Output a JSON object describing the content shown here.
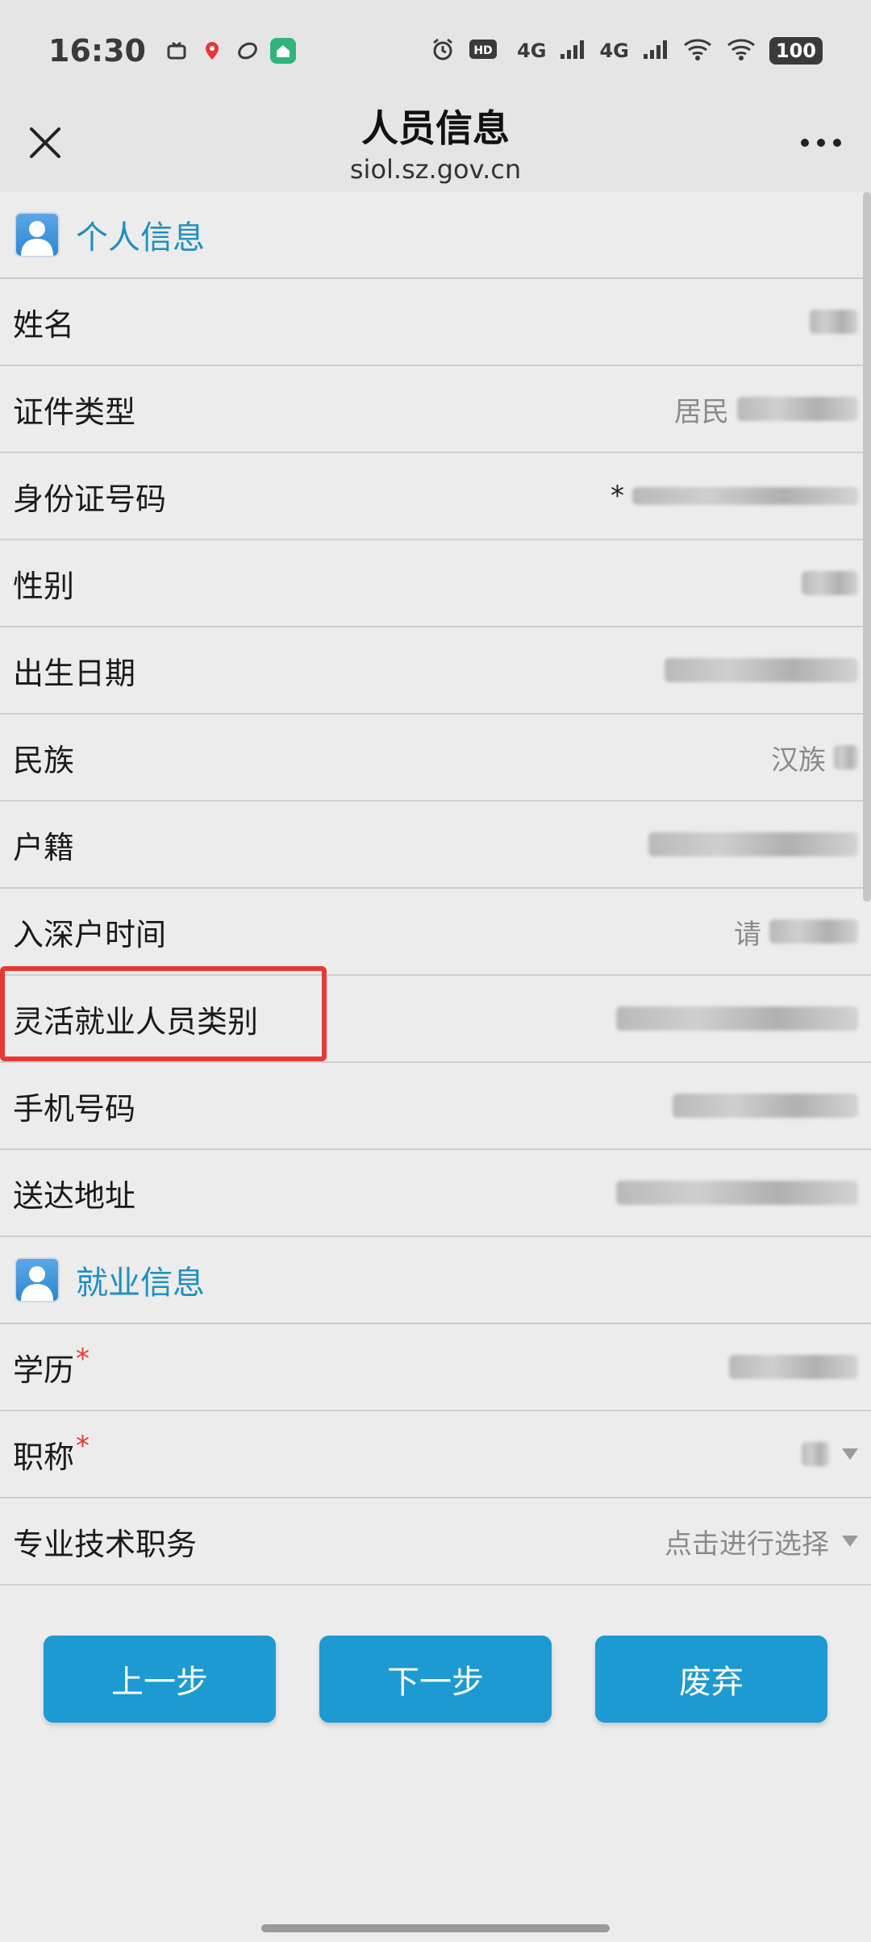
{
  "status_bar": {
    "time": "16:30",
    "network_label": "4G",
    "battery": "100",
    "icons": [
      "tv-icon",
      "map-pin-icon",
      "loop-icon",
      "home-app-icon",
      "alarm-icon",
      "hd-icon",
      "signal-icon",
      "wifi-icon"
    ]
  },
  "header": {
    "title": "人员信息",
    "subtitle": "siol.sz.gov.cn",
    "close_icon": "close-icon",
    "more_icon": "more-icon"
  },
  "sections": [
    {
      "title": "个人信息",
      "rows": [
        {
          "label": "姓名",
          "value": ""
        },
        {
          "label": "证件类型",
          "value": "居民"
        },
        {
          "label": "身份证号码",
          "value": "*"
        },
        {
          "label": "性别",
          "value": ""
        },
        {
          "label": "出生日期",
          "value": ""
        },
        {
          "label": "民族",
          "value": "汉族"
        },
        {
          "label": "户籍",
          "value": ""
        },
        {
          "label": "入深户时间",
          "value": "请"
        },
        {
          "label": "灵活就业人员类别",
          "value": ""
        },
        {
          "label": "手机号码",
          "value": ""
        },
        {
          "label": "送达地址",
          "value": ""
        }
      ]
    },
    {
      "title": "就业信息",
      "rows": [
        {
          "label": "学历",
          "required": "*",
          "value": ""
        },
        {
          "label": "职称",
          "required": "*",
          "value": ""
        },
        {
          "label": "专业技术职务",
          "value": "点击进行选择"
        }
      ]
    }
  ],
  "buttons": {
    "prev": "上一步",
    "next": "下一步",
    "discard": "废弃"
  },
  "colors": {
    "accent": "#1c9ad1",
    "section_title": "#1f8fc0",
    "highlight": "#e53935"
  }
}
